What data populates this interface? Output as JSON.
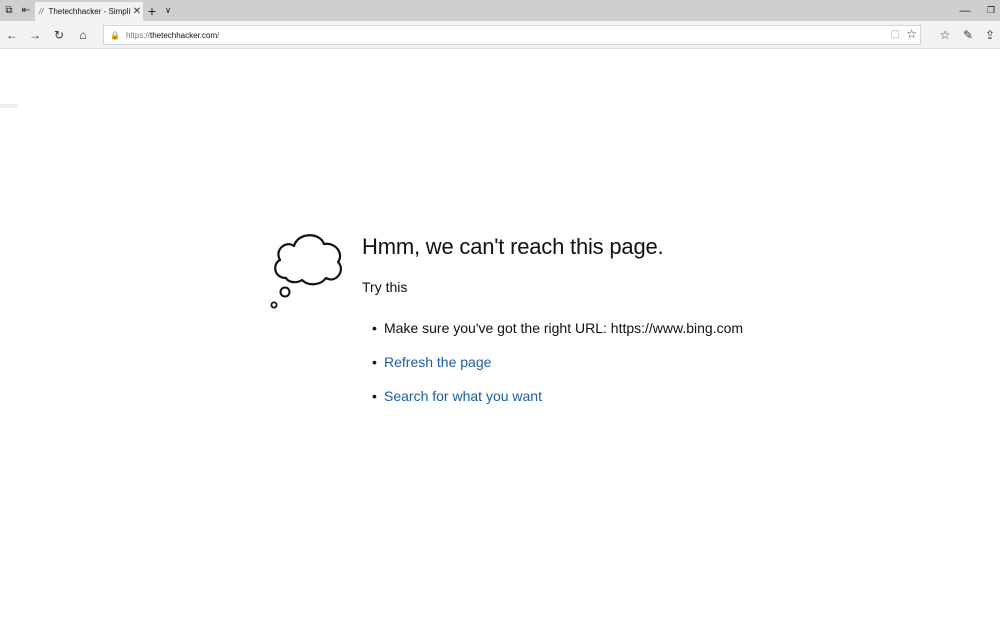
{
  "tabstrip": {
    "tab_title": "Thetechhacker - Simplif",
    "tab_favicon": "//",
    "close_glyph": "✕",
    "new_tab_glyph": "+",
    "tab_list_glyph": "∨",
    "minimize_glyph": "—",
    "restore_glyph": "❐",
    "aside_glyph": "⧉",
    "set_aside_glyph": "⇤"
  },
  "toolbar": {
    "back_glyph": "←",
    "forward_glyph": "→",
    "refresh_glyph": "↻",
    "home_glyph": "⌂",
    "address": {
      "scheme": "https://",
      "host": "thetechhacker.com",
      "path": "/"
    },
    "lock_glyph": "🔒",
    "reading_view_glyph": "▢",
    "favorite_glyph": "☆",
    "favorites_hub_glyph": "☆",
    "notes_glyph": "✎",
    "share_glyph": "⇪"
  },
  "error": {
    "heading": "Hmm, we can't reach this page.",
    "subheading": "Try this",
    "bullet": "•",
    "suggestions": [
      {
        "label": "Make sure you've got the right URL: https://www.bing.com"
      },
      {
        "label": "Refresh the page"
      },
      {
        "label": "Search for what you want"
      }
    ]
  },
  "colors": {
    "tabstrip_bg": "#cfcfcf",
    "toolbar_bg": "#f2f2f2",
    "link": "#1a5ea8",
    "text": "#111111"
  }
}
